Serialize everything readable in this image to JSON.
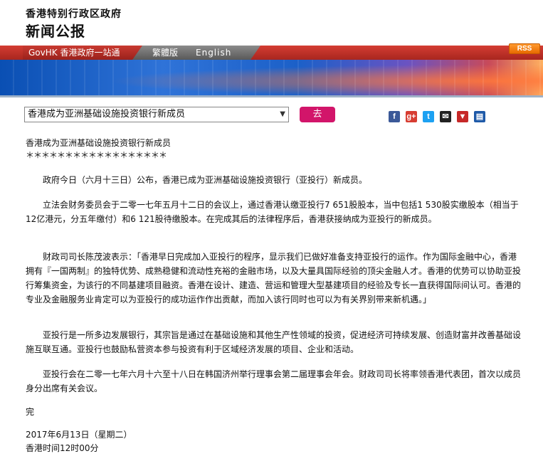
{
  "header": {
    "government_name": "香港特别行政区政府",
    "press_release_title": "新闻公报"
  },
  "nav": {
    "govhk_link": "GovHK 香港政府一站通",
    "traditional_link": "繁體版",
    "english_link": "English",
    "rss_label": "RSS",
    "rss_icon": "rss-feed-icon"
  },
  "toolbar": {
    "selected_article": "香港成为亚洲基础设施投资银行新成员",
    "go_button": "去",
    "share_icons": [
      {
        "name": "facebook-icon",
        "glyph": "f",
        "color": "#3b5998"
      },
      {
        "name": "google-plus-icon",
        "glyph": "g+",
        "color": "#d73d32"
      },
      {
        "name": "twitter-icon",
        "glyph": "t",
        "color": "#1da1f2"
      },
      {
        "name": "email-icon",
        "glyph": "✉",
        "color": "#222222"
      },
      {
        "name": "bookmark-icon",
        "glyph": "▼",
        "color": "#c62828"
      },
      {
        "name": "print-icon",
        "glyph": "▤",
        "color": "#1f5aa8"
      }
    ]
  },
  "article": {
    "title": "香港成为亚洲基础设施投资银行新成员",
    "separator": "＊＊＊＊＊＊＊＊＊＊＊＊＊＊＊＊＊＊",
    "paragraphs": [
      "政府今日（六月十三日）公布，香港已成为亚洲基础设施投资银行（亚投行）新成员。",
      "立法会财务委员会于二零一七年五月十二日的会议上，通过香港认缴亚投行7 651股股本，当中包括1 530股实缴股本（相当于12亿港元，分五年缴付）和6 121股待缴股本。在完成其后的法律程序后，香港获接纳成为亚投行的新成员。",
      "财政司司长陈茂波表示：「香港早日完成加入亚投行的程序，显示我们已做好准备支持亚投行的运作。作为国际金融中心，香港拥有『一国两制』的独特优势、成熟稳健和流动性充裕的金融市场，以及大量具国际经验的顶尖金融人才。香港的优势可以协助亚投行筹集资金，为该行的不同基建项目融资。香港在设计、建造、营运和管理大型基建项目的经验及专长一直获得国际间认可。香港的专业及金融服务业肯定可以为亚投行的成功运作作出贡献，而加入该行同时也可以为有关界别带来新机遇。」",
      "亚投行是一所多边发展银行，其宗旨是通过在基础设施和其他生产性领域的投资，促进经济可持续发展、创造财富并改善基础设施互联互通。亚投行也鼓励私营资本参与投资有利于区域经济发展的项目、企业和活动。",
      "亚投行会在二零一七年六月十六至十八日在韩国济州举行理事会第二届理事会年会。财政司司长将率领香港代表团，首次以成员身分出席有关会议。"
    ],
    "end_mark": "完",
    "date": "2017年6月13日（星期二）",
    "time": "香港时间12时00分"
  }
}
